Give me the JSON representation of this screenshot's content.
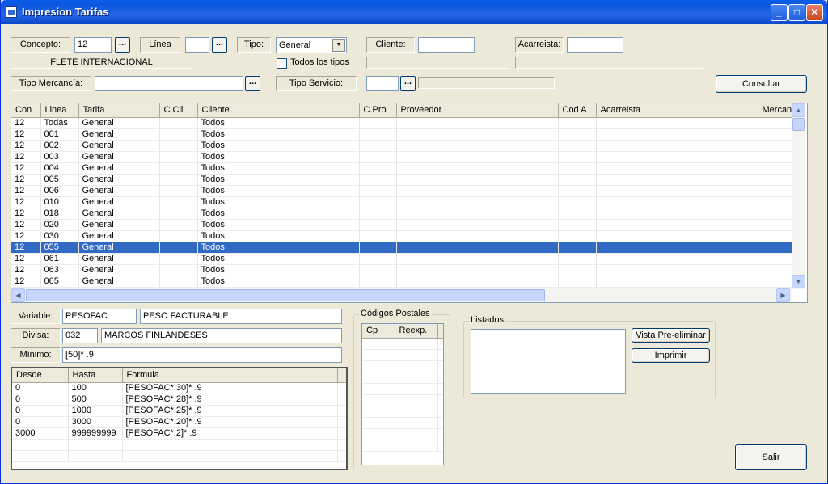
{
  "window": {
    "title": "Impresion Tarifas"
  },
  "filters": {
    "concepto_label": "Concepto:",
    "concepto_value": "12",
    "concepto_desc": "FLETE INTERNACIONAL",
    "linea_label": "Línea",
    "linea_value": "",
    "tipo_label": "Tipo:",
    "tipo_value": "General",
    "todos_tipos_label": "Todos los tipos",
    "cliente_label": "Cliente:",
    "cliente_value": "",
    "acarreista_label": "Acarreista:",
    "acarreista_value": "",
    "tipo_mercancia_label": "Tipo Mercancía:",
    "tipo_mercancia_value": "",
    "tipo_servicio_label": "Tipo Servicio:",
    "tipo_servicio_value": "",
    "ellipsis": "...",
    "consultar_label": "Consultar"
  },
  "main_grid": {
    "columns": [
      "Con",
      "Linea",
      "Tarifa",
      "C.Cli",
      "Cliente",
      "C.Pro",
      "Proveedor",
      "Cod A",
      "Acarreista",
      "Mercan"
    ],
    "rows": [
      [
        "12",
        "Todas",
        "General",
        "",
        "Todos"
      ],
      [
        "12",
        "001",
        "General",
        "",
        "Todos"
      ],
      [
        "12",
        "002",
        "General",
        "",
        "Todos"
      ],
      [
        "12",
        "003",
        "General",
        "",
        "Todos"
      ],
      [
        "12",
        "004",
        "General",
        "",
        "Todos"
      ],
      [
        "12",
        "005",
        "General",
        "",
        "Todos"
      ],
      [
        "12",
        "006",
        "General",
        "",
        "Todos"
      ],
      [
        "12",
        "010",
        "General",
        "",
        "Todos"
      ],
      [
        "12",
        "018",
        "General",
        "",
        "Todos"
      ],
      [
        "12",
        "020",
        "General",
        "",
        "Todos"
      ],
      [
        "12",
        "030",
        "General",
        "",
        "Todos"
      ],
      [
        "12",
        "055",
        "General",
        "",
        "Todos"
      ],
      [
        "12",
        "061",
        "General",
        "",
        "Todos"
      ],
      [
        "12",
        "063",
        "General",
        "",
        "Todos"
      ],
      [
        "12",
        "065",
        "General",
        "",
        "Todos"
      ]
    ],
    "selected_row": 11
  },
  "details": {
    "variable_label": "Variable:",
    "variable_code": "PESOFAC",
    "variable_desc": "PESO FACTURABLE",
    "divisa_label": "Divisa:",
    "divisa_code": "032",
    "divisa_desc": "MARCOS FINLANDESES",
    "minimo_label": "Mínimo:",
    "minimo_value": "[50]* .9"
  },
  "formula_grid": {
    "columns": [
      "Desde",
      "Hasta",
      "Formula"
    ],
    "rows": [
      [
        "0",
        "100",
        "[PESOFAC*.30]* .9"
      ],
      [
        "0",
        "500",
        "[PESOFAC*.28]* .9"
      ],
      [
        "0",
        "1000",
        "[PESOFAC*.25]* .9"
      ],
      [
        "0",
        "3000",
        "[PESOFAC*.20]* .9"
      ],
      [
        "3000",
        "999999999",
        "[PESOFAC*.2]* .9"
      ]
    ]
  },
  "codigos_postales": {
    "caption": "Códigos Postales",
    "columns": [
      "Cp",
      "Reexp."
    ]
  },
  "listados": {
    "caption": "Listados",
    "vista_label": "Vista Pre-eliminar",
    "imprimir_label": "Imprimir"
  },
  "salir_label": "Salir"
}
